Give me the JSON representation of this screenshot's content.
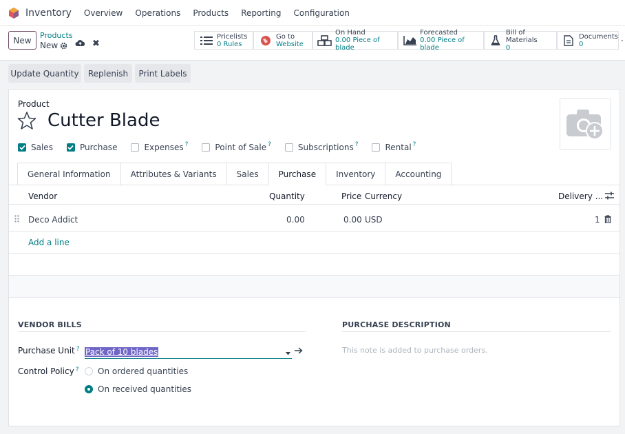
{
  "nav": {
    "app_name": "Inventory",
    "items": [
      "Overview",
      "Operations",
      "Products",
      "Reporting",
      "Configuration"
    ]
  },
  "control_panel": {
    "new_label": "New",
    "breadcrumb_parent": "Products",
    "breadcrumb_current": "New",
    "smart_buttons": [
      {
        "line1": "Pricelists",
        "line2": "0 Rules",
        "icon": "list-icon"
      },
      {
        "line1": "Go to",
        "line2": "Website",
        "icon": "globe-icon"
      },
      {
        "line1": "On Hand",
        "line2": "0.00 Piece of blade",
        "icon": "boxes-icon"
      },
      {
        "line1": "Forecasted",
        "line2": "0.00 Piece of blade",
        "icon": "area-chart-icon"
      },
      {
        "line1": "Bill of Materials",
        "line2": "0",
        "icon": "flask-icon"
      },
      {
        "line1": "Documents",
        "line2": "0",
        "icon": "document-icon"
      }
    ]
  },
  "actions": {
    "update_quantity": "Update Quantity",
    "replenish": "Replenish",
    "print_labels": "Print Labels"
  },
  "product": {
    "label": "Product",
    "name": "Cutter Blade",
    "checkboxes": [
      {
        "label": "Sales",
        "checked": true,
        "help": false
      },
      {
        "label": "Purchase",
        "checked": true,
        "help": false
      },
      {
        "label": "Expenses",
        "checked": false,
        "help": true
      },
      {
        "label": "Point of Sale",
        "checked": false,
        "help": true
      },
      {
        "label": "Subscriptions",
        "checked": false,
        "help": true
      },
      {
        "label": "Rental",
        "checked": false,
        "help": true
      }
    ],
    "help_mark": "?"
  },
  "tabs": [
    "General Information",
    "Attributes & Variants",
    "Sales",
    "Purchase",
    "Inventory",
    "Accounting"
  ],
  "active_tab": "Purchase",
  "vendor_table": {
    "headers": {
      "vendor": "Vendor",
      "quantity": "Quantity",
      "price": "Price",
      "currency": "Currency",
      "delivery": "Delivery ..."
    },
    "rows": [
      {
        "vendor": "Deco Addict",
        "quantity": "0.00",
        "price": "0.00",
        "currency": "USD",
        "delivery": "1"
      }
    ],
    "add_line": "Add a line"
  },
  "vendor_bills": {
    "title": "VENDOR BILLS",
    "purchase_unit_label": "Purchase Unit",
    "purchase_unit_value": "Pack of 10 blades",
    "control_policy_label": "Control Policy",
    "options": [
      {
        "label": "On ordered quantities",
        "selected": false
      },
      {
        "label": "On received quantities",
        "selected": true
      }
    ]
  },
  "purchase_description": {
    "title": "PURCHASE DESCRIPTION",
    "placeholder": "This note is added to purchase orders."
  },
  "colors": {
    "accent": "#017e84",
    "brand": "#714b67",
    "selection": "#7066c7"
  }
}
